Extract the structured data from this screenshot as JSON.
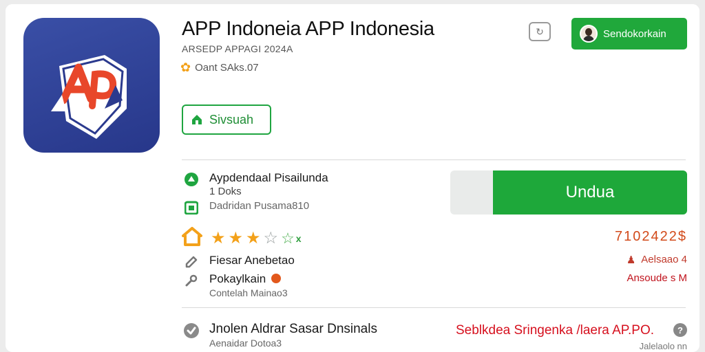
{
  "header": {
    "app_title": "APP Indoneia APP Indonesia",
    "subtitle": "ARSEDP APPAGI 2024A",
    "rating_text": "Oant SAks.07",
    "status_button": "Sivsuah",
    "cta_button": "Sendokorkain"
  },
  "details": {
    "developer_line1": "Aypdendaal Pisailunda",
    "developer_line2": "1 Doks",
    "developer_line3": "Dadridan Pusama810",
    "download_button": "Undua",
    "rating_count": "7102422$",
    "rating_stars": 3.5
  },
  "info_rows": [
    {
      "label": "Fiesar Anebetao"
    },
    {
      "label": "Pokaylkain",
      "sub": "Contelah Mainao3"
    }
  ],
  "right_info": {
    "line1": "Aelsaao 4",
    "line2": "Ansoude s M"
  },
  "bottom": {
    "main_text": "Jnolen Aldrar Sasar Dnsinals",
    "sub_text": "Aenaidar Dotoa3",
    "red_text": "Seblkdea Sringenka /laera AP.PO.",
    "help_label": "?",
    "muted_text": "Jalelaolo nn"
  },
  "colors": {
    "accent_green": "#20a83b",
    "icon_blue": "#2e3f96",
    "star_orange": "#f3a11a",
    "warning_red": "#d6101e"
  }
}
